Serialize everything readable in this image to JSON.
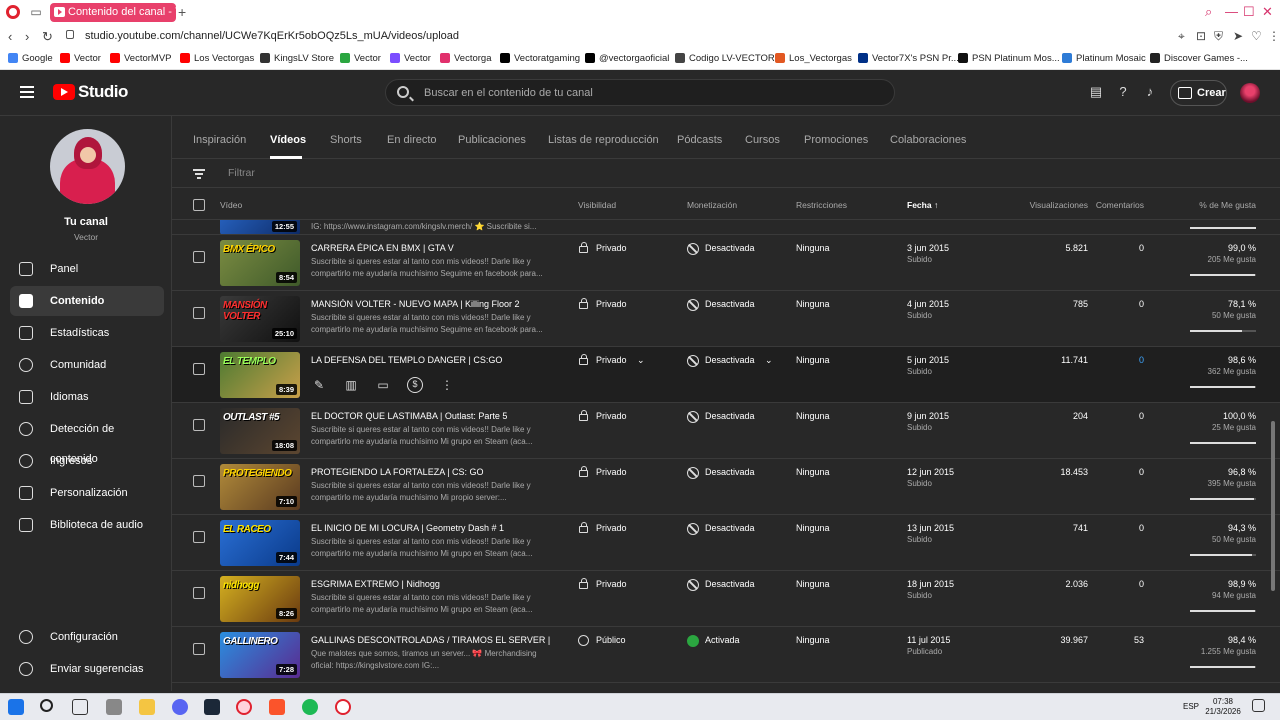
{
  "browser": {
    "tab_title": "Contenido del canal - YouTube Studio",
    "url": "studio.youtube.com/channel/UCWe7KqErKr5obOQz5Ls_mUA/videos/upload",
    "bookmarks": [
      "Google",
      "Vector",
      "VectorMVP",
      "Los Vectorgas",
      "KingsLV Store",
      "Vector",
      "Vector",
      "Vectorga",
      "Vectoratgaming",
      "@vectorgaoficial",
      "Codigo LV-VECTOR",
      "Los_Vectorgas",
      "Vector7X's PSN Pr...",
      "PSN Platinum Mos...",
      "Platinum Mosaic",
      "Discover Games -..."
    ]
  },
  "header": {
    "logo_text": "Studio",
    "search_placeholder": "Buscar en el contenido de tu canal",
    "create_label": "Crear"
  },
  "sidebar": {
    "channel_name": "Tu canal",
    "channel_handle": "Vector",
    "items": [
      {
        "label": "Panel"
      },
      {
        "label": "Contenido"
      },
      {
        "label": "Estadísticas"
      },
      {
        "label": "Comunidad"
      },
      {
        "label": "Idiomas"
      },
      {
        "label": "Detección de contenido"
      },
      {
        "label": "Ingresos"
      },
      {
        "label": "Personalización"
      },
      {
        "label": "Biblioteca de audio"
      }
    ],
    "bottom_items": [
      {
        "label": "Configuración"
      },
      {
        "label": "Enviar sugerencias"
      }
    ]
  },
  "tabs": [
    "Inspiración",
    "Vídeos",
    "Shorts",
    "En directo",
    "Publicaciones",
    "Listas de reproducción",
    "Pódcasts",
    "Cursos",
    "Promociones",
    "Colaboraciones"
  ],
  "filter_placeholder": "Filtrar",
  "columns": {
    "video": "Vídeo",
    "visibility": "Visibilidad",
    "monetization": "Monetización",
    "restrictions": "Restricciones",
    "date": "Fecha",
    "views": "Visualizaciones",
    "comments": "Comentarios",
    "likes": "% de Me gusta"
  },
  "partial_row": {
    "duration": "12:55",
    "description": "IG: https://www.instagram.com/kingslv.merch/ ⭐ Suscribite si..."
  },
  "rows": [
    {
      "thumb_text": "BMX ÉPICO",
      "duration": "8:54",
      "title": "CARRERA ÉPICA EN BMX | GTA V",
      "description": "Suscribite si queres estar al tanto con mis videos!! Darle like y compartirlo me ayudaría muchísimo Seguime en facebook para...",
      "visibility": "Privado",
      "monetization": "Desactivada",
      "restrictions": "Ninguna",
      "date": "3 jun 2015",
      "status": "Subido",
      "views": "5.821",
      "comments": "0",
      "likes": "99,0 %",
      "likes_sub": "205 Me gusta",
      "like_ratio": 0.99
    },
    {
      "thumb_text": "MANSIÓN VOLTER",
      "duration": "25:10",
      "title": "MANSIÓN VOLTER - NUEVO MAPA | Killing Floor 2",
      "description": "Suscribite si queres estar al tanto con mis videos!! Darle like y compartirlo me ayudaría muchísimo Seguime en facebook para...",
      "visibility": "Privado",
      "monetization": "Desactivada",
      "restrictions": "Ninguna",
      "date": "4 jun 2015",
      "status": "Subido",
      "views": "785",
      "comments": "0",
      "likes": "78,1 %",
      "likes_sub": "50 Me gusta",
      "like_ratio": 0.781
    },
    {
      "thumb_text": "EL TEMPLO",
      "duration": "8:39",
      "title": "LA DEFENSA DEL TEMPLO DANGER | CS:GO",
      "description": "",
      "visibility": "Privado",
      "monetization": "Desactivada",
      "restrictions": "Ninguna",
      "date": "5 jun 2015",
      "status": "Subido",
      "views": "11.741",
      "comments": "0",
      "likes": "98,6 %",
      "likes_sub": "362 Me gusta",
      "like_ratio": 0.986
    },
    {
      "thumb_text": "OUTLAST #5",
      "duration": "18:08",
      "title": "EL DOCTOR QUE LASTIMABA | Outlast: Parte 5",
      "description": "Suscribite si queres estar al tanto con mis videos!! Darle like y compartirlo me ayudaría muchísimo Mi grupo en Steam (aca...",
      "visibility": "Privado",
      "monetization": "Desactivada",
      "restrictions": "Ninguna",
      "date": "9 jun 2015",
      "status": "Subido",
      "views": "204",
      "comments": "0",
      "likes": "100,0 %",
      "likes_sub": "25 Me gusta",
      "like_ratio": 1.0
    },
    {
      "thumb_text": "PROTEGIENDO",
      "duration": "7:10",
      "title": "PROTEGIENDO LA FORTALEZA | CS: GO",
      "description": "Suscribite si queres estar al tanto con mis videos!! Darle like y compartirlo me ayudaría muchísimo Mi propio server:...",
      "visibility": "Privado",
      "monetization": "Desactivada",
      "restrictions": "Ninguna",
      "date": "12 jun 2015",
      "status": "Subido",
      "views": "18.453",
      "comments": "0",
      "likes": "96,8 %",
      "likes_sub": "395 Me gusta",
      "like_ratio": 0.968
    },
    {
      "thumb_text": "EL RACEO",
      "duration": "7:44",
      "title": "EL INICIO DE MI LOCURA | Geometry Dash # 1",
      "description": "Suscribite si queres estar al tanto con mis videos!! Darle like y compartirlo me ayudaría muchísimo Mi grupo en Steam (aca...",
      "visibility": "Privado",
      "monetization": "Desactivada",
      "restrictions": "Ninguna",
      "date": "13 jun 2015",
      "status": "Subido",
      "views": "741",
      "comments": "0",
      "likes": "94,3 %",
      "likes_sub": "50 Me gusta",
      "like_ratio": 0.943
    },
    {
      "thumb_text": "nidhogg",
      "duration": "8:26",
      "title": "ESGRIMA EXTREMO | Nidhogg",
      "description": "Suscribite si queres estar al tanto con mis videos!! Darle like y compartirlo me ayudaría muchísimo Mi grupo en Steam (aca...",
      "visibility": "Privado",
      "monetization": "Desactivada",
      "restrictions": "Ninguna",
      "date": "18 jun 2015",
      "status": "Subido",
      "views": "2.036",
      "comments": "0",
      "likes": "98,9 %",
      "likes_sub": "94 Me gusta",
      "like_ratio": 0.989
    },
    {
      "thumb_text": "GALLINERO",
      "duration": "7:28",
      "title": "GALLINAS DESCONTROLADAS / TIRAMOS EL SERVER | CS: ...",
      "description": "Que malotes que somos, tiramos un server... 🎀 Merchandising oficial: https://kingslvstore.com IG:...",
      "visibility": "Público",
      "monetization": "Activada",
      "restrictions": "Ninguna",
      "date": "11 jul 2015",
      "status": "Publicado",
      "views": "39.967",
      "comments": "53",
      "likes": "98,4 %",
      "likes_sub": "1.255 Me gusta",
      "like_ratio": 0.984
    }
  ],
  "taskbar": {
    "time": "07:38",
    "date": "21/3/2026",
    "lang": "ESP"
  },
  "colors": {
    "accent_red": "#ff0000",
    "tab_pink": "#e8406b",
    "link_blue": "#3ea6ff",
    "monetization_green": "#2ba640"
  }
}
